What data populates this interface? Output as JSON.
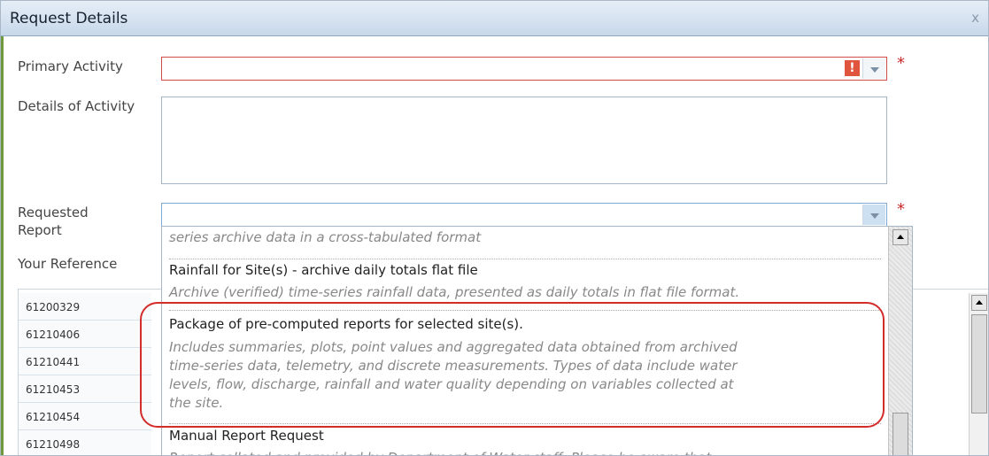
{
  "dialog": {
    "title": "Request Details",
    "close_symbol": "x"
  },
  "form": {
    "primary_activity_label": "Primary Activity",
    "details_label": "Details of Activity",
    "requested_report_label_line1": "Requested",
    "requested_report_label_line2": "Report",
    "your_reference_label": "Your Reference",
    "required_marker": "*",
    "error_marker": "!"
  },
  "dropdown": {
    "partial_desc": "series archive data in a cross-tabulated format",
    "items": [
      {
        "title": "Rainfall for Site(s) - archive daily totals flat file",
        "desc": "Archive (verified) time-series rainfall data, presented as daily totals in flat file format."
      },
      {
        "title": "Package of pre-computed reports for selected site(s).",
        "desc_lines": [
          "Includes summaries, plots, point values and aggregated data obtained from archived",
          "time-series data, telemetry, and discrete measurements. Types of data include water",
          "levels, flow, discharge, rainfall and water quality depending on variables collected at",
          "the site."
        ]
      },
      {
        "title": "Manual Report Request",
        "desc": "Report collated and provided by Department of Water staff. Please be aware that"
      }
    ]
  },
  "grid": {
    "rows": [
      "61200329",
      "61210406",
      "61210441",
      "61210453",
      "61210454",
      "61210498"
    ]
  },
  "colors": {
    "title_bar": "#c7d8ea",
    "required": "#cc2a2a",
    "highlight": "#d42b2b",
    "frame_accent": "#6e9a3c"
  }
}
